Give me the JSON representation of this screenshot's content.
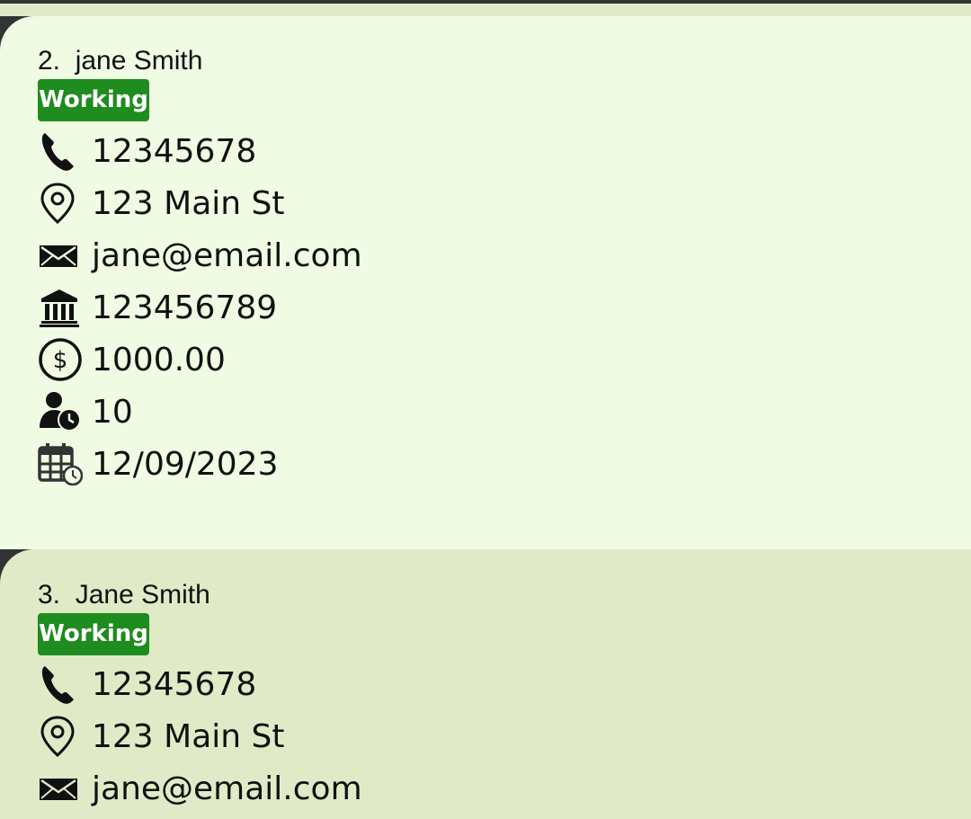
{
  "colors": {
    "card_selected_bg": "#effbe3",
    "card_bg": "#e0eac6",
    "badge_bg": "#1e8c1e",
    "border": "#333333"
  },
  "cards": [
    {
      "index": "2.",
      "name": "jane Smith",
      "status": "Working",
      "phone": "12345678",
      "address": "123 Main St",
      "email": "jane@email.com",
      "bank_account": "123456789",
      "salary": "1000.00",
      "leave_days": "10",
      "date": "12/09/2023"
    },
    {
      "index": "3.",
      "name": "Jane Smith",
      "status": "Working",
      "phone": "12345678",
      "address": "123 Main St",
      "email": "jane@email.com"
    }
  ]
}
